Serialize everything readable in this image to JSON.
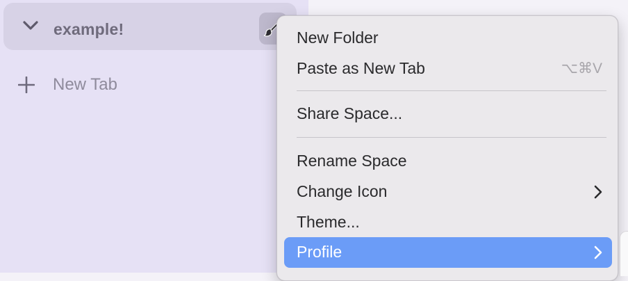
{
  "sidebar": {
    "space": {
      "name": "example!",
      "toggle_icon": "chevron-down-icon",
      "theme_icon": "paintbrush-icon"
    },
    "new_tab": {
      "icon": "plus-icon",
      "label": "New Tab"
    }
  },
  "context_menu": {
    "items": [
      {
        "label": "New Folder"
      },
      {
        "label": "Paste as New Tab",
        "shortcut": "⌥⌘V"
      },
      {
        "label": "Share Space..."
      },
      {
        "label": "Rename Space"
      },
      {
        "label": "Change Icon",
        "submenu_icon": "chevron-right-icon"
      },
      {
        "label": "Theme..."
      },
      {
        "label": "Profile",
        "submenu_icon": "chevron-right-icon",
        "highlighted": true
      }
    ],
    "highlight_color": "#6b9cf7"
  }
}
